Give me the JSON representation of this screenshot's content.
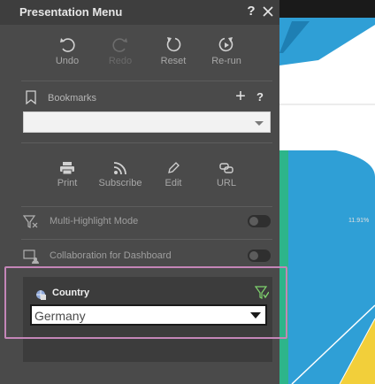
{
  "panel": {
    "title": "Presentation Menu",
    "help_label": "?",
    "toolbar": [
      {
        "label": "Undo",
        "icon": "undo-icon",
        "enabled": true
      },
      {
        "label": "Redo",
        "icon": "redo-icon",
        "enabled": false
      },
      {
        "label": "Reset",
        "icon": "reset-icon",
        "enabled": true
      },
      {
        "label": "Re-run",
        "icon": "rerun-icon",
        "enabled": true
      }
    ],
    "bookmarks": {
      "label": "Bookmarks",
      "add_label": "+",
      "help_label": "?",
      "selected": ""
    },
    "actions": [
      {
        "label": "Print",
        "icon": "print-icon"
      },
      {
        "label": "Subscribe",
        "icon": "rss-icon"
      },
      {
        "label": "Edit",
        "icon": "pencil-icon"
      },
      {
        "label": "URL",
        "icon": "link-icon"
      }
    ],
    "options": [
      {
        "label": "Multi-Highlight Mode",
        "icon": "multi-highlight-icon",
        "enabled": false
      },
      {
        "label": "Collaboration for Dashboard",
        "icon": "collaboration-icon",
        "enabled": false
      }
    ],
    "filter": {
      "label": "Country",
      "selected": "Germany"
    }
  },
  "background": {
    "percent_label": "11.91%"
  },
  "colors": {
    "panel_bg": "#4a4a4a",
    "titlebar_bg": "#3e3e3e",
    "highlight_frame": "#c486b8",
    "chart_blue": "#2f9fd6",
    "chart_green": "#2db58a",
    "chart_yellow": "#f2cf3a"
  }
}
